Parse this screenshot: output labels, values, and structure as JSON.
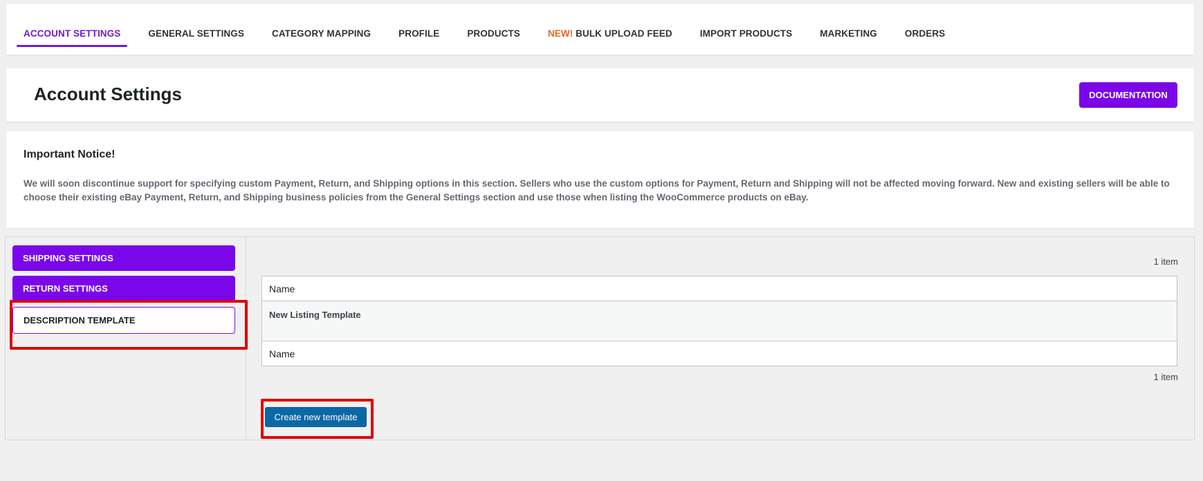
{
  "nav": {
    "tabs": [
      {
        "label": "ACCOUNT SETTINGS"
      },
      {
        "label": "GENERAL SETTINGS"
      },
      {
        "label": "CATEGORY MAPPING"
      },
      {
        "label": "PROFILE"
      },
      {
        "label": "PRODUCTS"
      },
      {
        "badge": "NEW!",
        "label": "BULK UPLOAD FEED"
      },
      {
        "label": "IMPORT PRODUCTS"
      },
      {
        "label": "MARKETING"
      },
      {
        "label": "ORDERS"
      }
    ],
    "active_tab": "ACCOUNT SETTINGS"
  },
  "header": {
    "title": "Account Settings",
    "documentation_label": "DOCUMENTATION"
  },
  "notice": {
    "title": "Important Notice!",
    "text": "We will soon discontinue support for specifying custom Payment, Return, and Shipping options in this section. Sellers who use the custom options for Payment, Return and Shipping will not be affected moving forward. New and existing sellers will be able to choose their existing eBay Payment, Return, and Shipping business policies from the General Settings section and use those when listing the WooCommerce products on eBay."
  },
  "sidebar": {
    "items": [
      {
        "label": "SHIPPING SETTINGS"
      },
      {
        "label": "RETURN SETTINGS"
      },
      {
        "label": "DESCRIPTION TEMPLATE"
      }
    ],
    "selected": "DESCRIPTION TEMPLATE"
  },
  "templates": {
    "count_top": "1 item",
    "count_bottom": "1 item",
    "column_header": "Name",
    "column_footer": "Name",
    "rows": [
      {
        "name": "New Listing Template"
      }
    ],
    "create_label": "Create new template"
  },
  "colors": {
    "accent": "#7a06ea",
    "nav_active": "#6f1bd6",
    "new_badge": "#e06a22",
    "primary_button": "#0b68a6",
    "highlight": "#e00000"
  }
}
